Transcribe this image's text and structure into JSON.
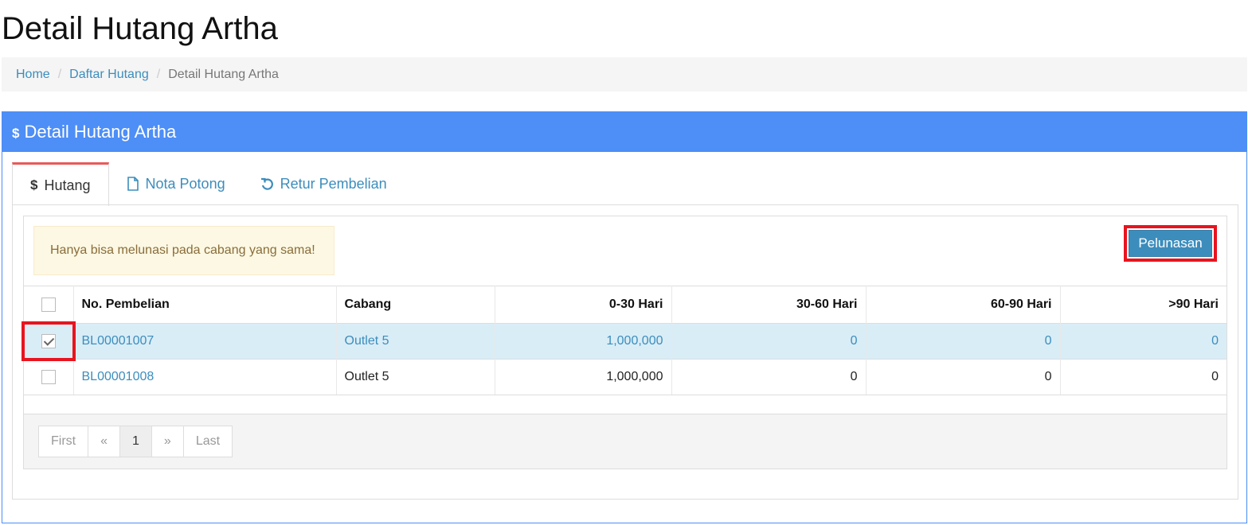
{
  "page_title": "Detail Hutang Artha",
  "breadcrumb": {
    "items": [
      "Home",
      "Daftar Hutang"
    ],
    "active": "Detail Hutang Artha"
  },
  "panel": {
    "title": "Detail Hutang Artha",
    "icon": "dollar-icon"
  },
  "tabs": [
    {
      "label": "Hutang",
      "icon": "dollar-icon",
      "active": true
    },
    {
      "label": "Nota Potong",
      "icon": "file-icon",
      "active": false
    },
    {
      "label": "Retur Pembelian",
      "icon": "undo-icon",
      "active": false
    }
  ],
  "alert": "Hanya bisa melunasi pada cabang yang sama!",
  "pelunasan_button": "Pelunasan",
  "table": {
    "headers": [
      "No. Pembelian",
      "Cabang",
      "0-30 Hari",
      "30-60 Hari",
      "60-90 Hari",
      ">90 Hari"
    ],
    "rows": [
      {
        "checked": true,
        "no": "BL00001007",
        "cabang": "Outlet 5",
        "d0_30": "1,000,000",
        "d30_60": "0",
        "d60_90": "0",
        "d90": "0"
      },
      {
        "checked": false,
        "no": "BL00001008",
        "cabang": "Outlet 5",
        "d0_30": "1,000,000",
        "d30_60": "0",
        "d60_90": "0",
        "d90": "0"
      }
    ]
  },
  "pagination": {
    "first": "First",
    "prev": "«",
    "current": "1",
    "next": "»",
    "last": "Last"
  },
  "colors": {
    "panel_header": "#4d8ef7",
    "link": "#3c8dbc",
    "highlight": "#e8141e",
    "selected_row": "#d9edf7",
    "alert_bg": "#fcf8e3"
  }
}
